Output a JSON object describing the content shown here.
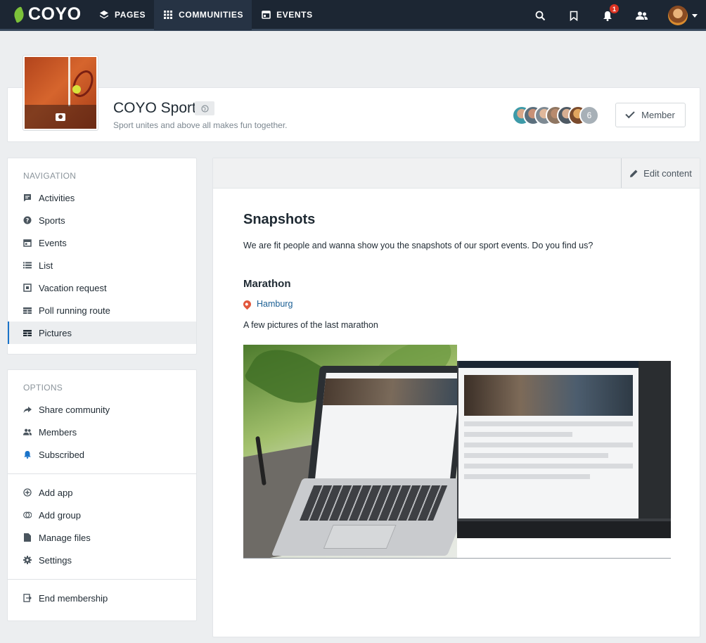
{
  "topbar": {
    "logo": "COYO",
    "nav": [
      {
        "label": "PAGES",
        "icon": "layers-icon"
      },
      {
        "label": "COMMUNITIES",
        "icon": "grid-icon",
        "active": true
      },
      {
        "label": "EVENTS",
        "icon": "calendar-icon"
      }
    ],
    "notification_count": "1"
  },
  "header": {
    "title": "COYO Sport",
    "subtitle": "Sport unites and above all makes fun together.",
    "member_count": "6",
    "member_button": "Member"
  },
  "navigation": {
    "heading": "NAVIGATION",
    "items": [
      {
        "label": "Activities",
        "icon": "chat-icon"
      },
      {
        "label": "Sports",
        "icon": "help-circle-icon"
      },
      {
        "label": "Events",
        "icon": "calendar-icon"
      },
      {
        "label": "List",
        "icon": "list-icon"
      },
      {
        "label": "Vacation request",
        "icon": "form-icon"
      },
      {
        "label": "Poll running route",
        "icon": "table-icon"
      },
      {
        "label": "Pictures",
        "icon": "table-icon",
        "active": true
      }
    ]
  },
  "options": {
    "heading": "OPTIONS",
    "items": [
      {
        "label": "Share community",
        "icon": "share-icon"
      },
      {
        "label": "Members",
        "icon": "members-icon"
      },
      {
        "label": "Subscribed",
        "icon": "bell-icon"
      }
    ],
    "admin": [
      {
        "label": "Add app",
        "icon": "plus-circle-icon"
      },
      {
        "label": "Add group",
        "icon": "add-group-icon"
      },
      {
        "label": "Manage files",
        "icon": "file-icon"
      },
      {
        "label": "Settings",
        "icon": "gear-icon"
      }
    ],
    "leave": {
      "label": "End membership",
      "icon": "exit-icon"
    }
  },
  "content": {
    "edit_label": "Edit content",
    "title": "Snapshots",
    "intro": "We are fit people and wanna show you the snapshots of our sport events. Do you find us?",
    "event_title": "Marathon",
    "location": "Hamburg",
    "description": "A few pictures of the last marathon"
  },
  "colors": {
    "topbar": "#1c2633",
    "accent": "#1a73c9",
    "location": "#1b5f94"
  }
}
